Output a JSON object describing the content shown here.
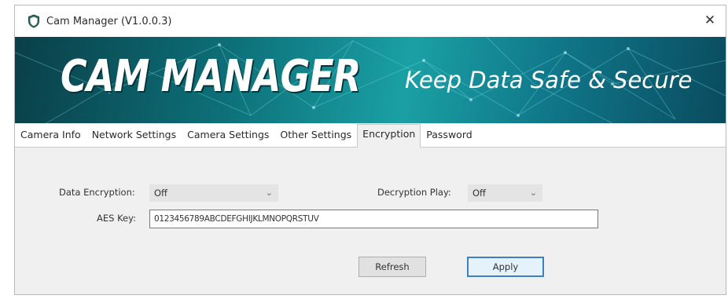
{
  "window": {
    "title": "Cam Manager (V1.0.0.3)",
    "close_glyph": "✕",
    "icon": "shield-icon"
  },
  "banner": {
    "title": "CAM MANAGER",
    "tagline": "Keep Data Safe & Secure"
  },
  "tabs": [
    {
      "label": "Camera Info",
      "active": false
    },
    {
      "label": "Network Settings",
      "active": false
    },
    {
      "label": "Camera Settings",
      "active": false
    },
    {
      "label": "Other Settings",
      "active": false
    },
    {
      "label": "Encryption",
      "active": true
    },
    {
      "label": "Password",
      "active": false
    }
  ],
  "encryption": {
    "data_encryption_label": "Data Encryption:",
    "data_encryption_value": "Off",
    "decryption_play_label": "Decryption Play:",
    "decryption_play_value": "Off",
    "aes_key_label": "AES Key:",
    "aes_key_value": "0123456789ABCDEFGHIJKLMNOPQRSTUV",
    "chevron_glyph": "⌄",
    "refresh_label": "Refresh",
    "apply_label": "Apply"
  },
  "colors": {
    "banner_dark": "#0a3f48",
    "banner_light": "#1aa0a4",
    "default_button_border": "#3c7fc2"
  }
}
